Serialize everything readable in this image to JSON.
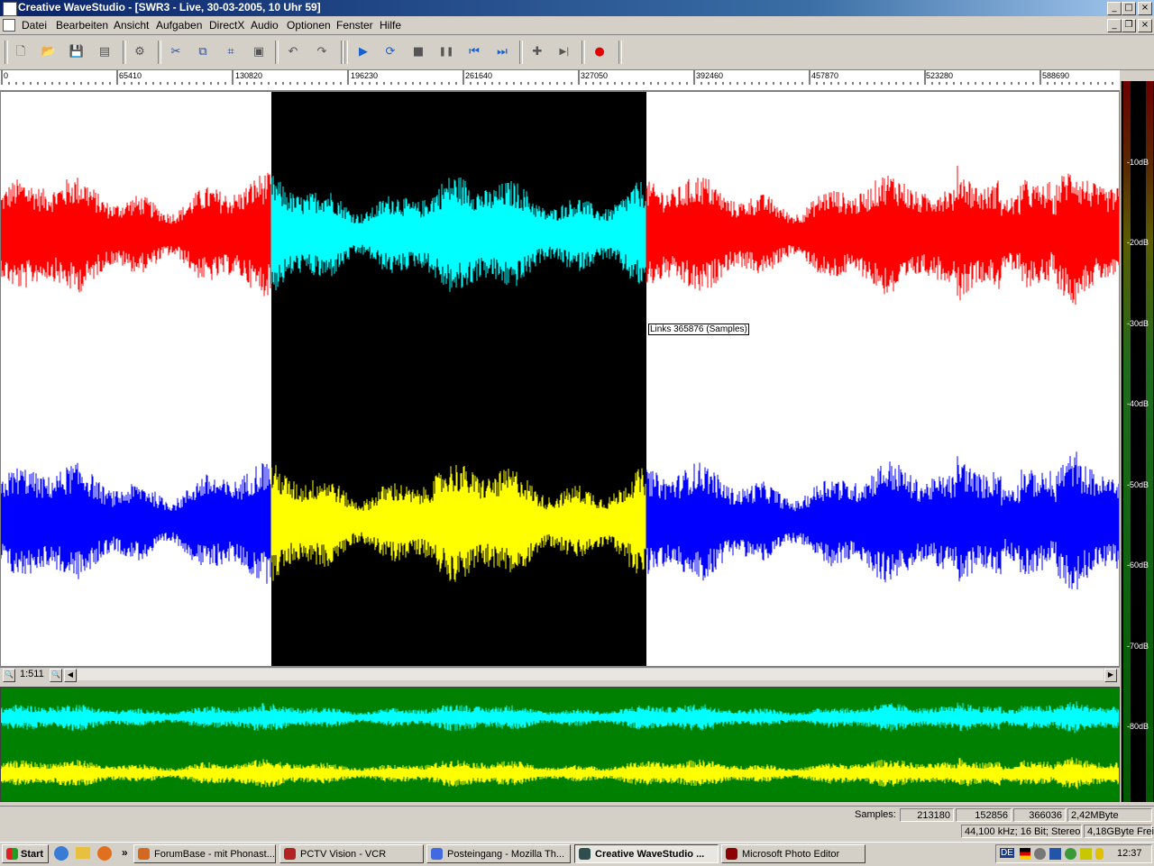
{
  "window": {
    "title": "Creative WaveStudio - [SWR3 - Live, 30-03-2005, 10 Uhr 59]",
    "min_glyph": "_",
    "max_glyph": "□",
    "close_glyph": "×",
    "restore_glyph": "❐"
  },
  "menu": [
    "Datei",
    "Bearbeiten",
    "Ansicht",
    "Aufgaben",
    "DirectX",
    "Audio",
    "Optionen",
    "Fenster",
    "Hilfe"
  ],
  "toolbar": [
    {
      "name": "new-file-icon",
      "glyph": "🗋"
    },
    {
      "name": "open-folder-icon",
      "glyph": "📂"
    },
    {
      "name": "save-icon",
      "glyph": "💾"
    },
    {
      "name": "save-all-icon",
      "glyph": "▤"
    },
    {
      "name": "properties-icon",
      "glyph": "⚙"
    },
    {
      "name": "cut-icon",
      "glyph": "✂"
    },
    {
      "name": "copy-icon",
      "glyph": "⧉"
    },
    {
      "name": "crop-icon",
      "glyph": "⌗"
    },
    {
      "name": "paste-icon",
      "glyph": "▣"
    },
    {
      "name": "undo-icon",
      "glyph": "↶"
    },
    {
      "name": "redo-icon",
      "glyph": "↷"
    },
    {
      "name": "play-icon",
      "glyph": "▶"
    },
    {
      "name": "loop-play-icon",
      "glyph": "⟳"
    },
    {
      "name": "stop-icon",
      "glyph": "■"
    },
    {
      "name": "pause-icon",
      "glyph": "❚❚"
    },
    {
      "name": "skip-start-icon",
      "glyph": "⏮"
    },
    {
      "name": "skip-end-icon",
      "glyph": "⏭"
    },
    {
      "name": "marker-icon",
      "glyph": "✚"
    },
    {
      "name": "goto-marker-icon",
      "glyph": "▶|"
    },
    {
      "name": "record-icon",
      "glyph": "●"
    }
  ],
  "ruler": [
    "0",
    "65410",
    "130820",
    "196230",
    "261640",
    "327050",
    "392460",
    "457870",
    "523280",
    "588690"
  ],
  "tooltip": "Links 365876 (Samples)",
  "zoom": {
    "level": "1:511",
    "zoom_out_glyph": "🔍",
    "zoom_in_glyph": "🔍",
    "left_glyph": "◀",
    "right_glyph": "▶"
  },
  "meter": [
    "-10dB",
    "-20dB",
    "-30dB",
    "-40dB",
    "-50dB",
    "-60dB",
    "-70dB",
    "-80dB"
  ],
  "status": {
    "samples_label": "Samples:",
    "selection_length": "213180",
    "selection_start": "152856",
    "selection_end": "366036",
    "size": "2,42MByte",
    "format": "44,100 kHz; 16 Bit; Stereo",
    "free": "4,18GByte Frei"
  },
  "taskbar": {
    "start": "Start",
    "more": "»",
    "tasks": [
      {
        "label": "ForumBase - mit Phonast...",
        "color": "#d2691e"
      },
      {
        "label": "PCTV Vision - VCR",
        "color": "#b22222"
      },
      {
        "label": "Posteingang - Mozilla Th...",
        "color": "#4169e1"
      },
      {
        "label": "Creative WaveStudio ...",
        "color": "#2f4f4f"
      },
      {
        "label": "Microsoft Photo Editor",
        "color": "#8b0000"
      }
    ],
    "lang": "DE",
    "clock": "12:37"
  },
  "colors": {
    "left_unselected": "#ff0000",
    "left_selected": "#00ffff",
    "right_unselected": "#0000ff",
    "right_selected": "#ffff00",
    "overview_bg": "#008000"
  }
}
